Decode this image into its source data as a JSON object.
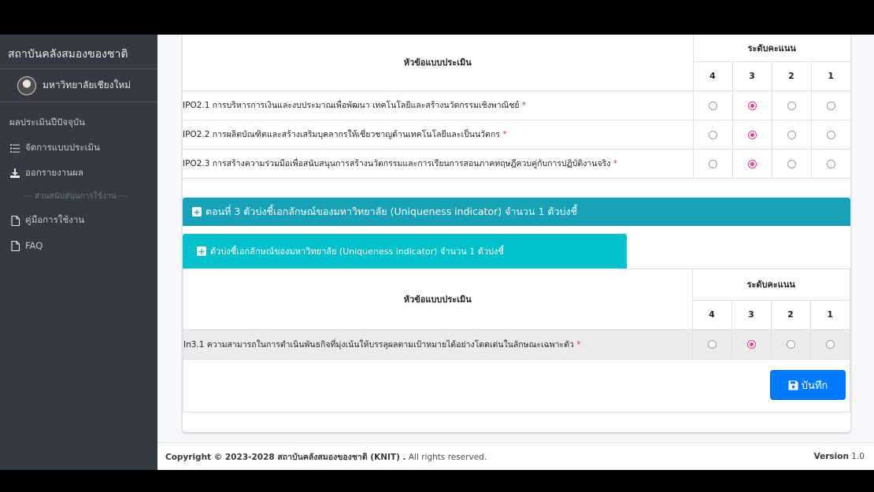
{
  "sidebar": {
    "brand": "สถาบันคลังสมองของชาติ",
    "user_name": "มหาวิทยาลัยเชียงใหม่",
    "items": [
      {
        "label": "ผลประเมินปีปัจจุบัน",
        "icon": "none"
      },
      {
        "label": "จัดการแบบประเมิน",
        "icon": "list-icon"
      },
      {
        "label": "ออกรายงานผล",
        "icon": "download-icon"
      }
    ],
    "section_header": "--- ส่วนสนับสนุนการใช้งาน ---",
    "support_items": [
      {
        "label": "คู่มือการใช้งาน",
        "icon": "file-icon"
      },
      {
        "label": "FAQ",
        "icon": "file-icon"
      }
    ]
  },
  "table1": {
    "header_question": "หัวข้อแบบประเมิน",
    "header_score": "ระดับคะแนน",
    "score_levels": [
      "4",
      "3",
      "2",
      "1"
    ],
    "rows": [
      {
        "text": "IPO2.1 การบริหารการเงินและงบประมาณเพื่อพัฒนา เทคโนโลยีและสร้างนวัตกรรมเชิงพาณิชย์",
        "required": "*",
        "selected": "3"
      },
      {
        "text": "IPO2.2 การผลิตบัณฑิตและสร้างเสริมบุคลากรให้เชี่ยวชาญด้านเทคโนโลยีและเป็นนวัตกร",
        "required": "*",
        "selected": "3"
      },
      {
        "text": "IPO2.3 การสร้างความร่วมมือเพื่อสนับสนุนการสร้างนวัตกรรมและการเรียนการสอนภาคทฤษฎีควบคู่กับการปฏิบัติงานจริง",
        "required": "*",
        "selected": "3"
      }
    ]
  },
  "section3": {
    "title": "ตอนที่ 3 ตัวบ่งชี้เอกลักษณ์ของมหาวิทยาลัย (Uniqueness indicator) จำนวน 1 ตัวบ่งชี้",
    "sub_tab": "ตัวบ่งชี้เอกลักษณ์ของมหาวิทยาลัย (Uniqueness indicator) จำนวน 1 ตัวบ่งชี้"
  },
  "table2": {
    "header_question": "หัวข้อแบบประเมิน",
    "header_score": "ระดับคะแนน",
    "score_levels": [
      "4",
      "3",
      "2",
      "1"
    ],
    "rows": [
      {
        "text": "In3.1 ความสามารถในการดำเนินพันธกิจที่มุ่งเน้นให้บรรลุผลตามเป้าหมายได้อย่างโดดเด่นในลักษณะเฉพาะตัว",
        "required": "*",
        "selected": "3"
      }
    ]
  },
  "save_button": {
    "label": "บันทึก",
    "icon": "save-icon"
  },
  "footer": {
    "copyright_prefix": "Copyright © 2023-2028 สถาบันคลังสมองของชาติ (KNIT) .",
    "rights": " All rights reserved.",
    "version_label": "Version",
    "version_value": " 1.0"
  },
  "colors": {
    "sidebar_bg": "#343a40",
    "section_bar": "#17a2b8",
    "sub_tab": "#00c0cc",
    "radio_checked": "#e83e8c",
    "primary_button": "#007bff",
    "required_mark": "#dc3545"
  }
}
